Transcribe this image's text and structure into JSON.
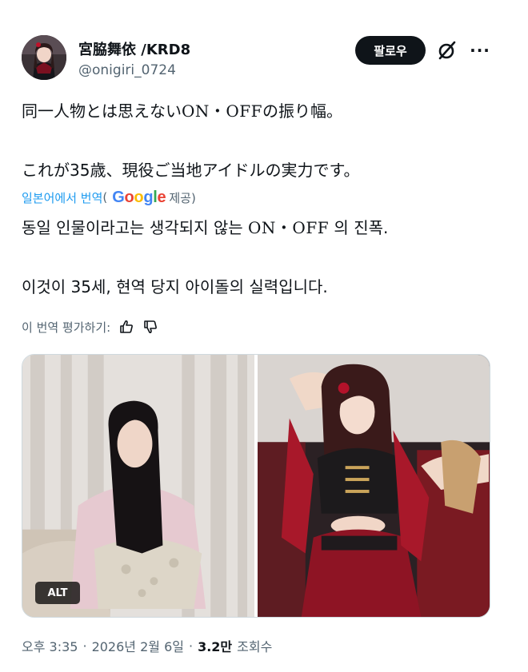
{
  "author": {
    "display_name": "宮脇舞依 /KRD8",
    "handle": "@onigiri_0724"
  },
  "actions": {
    "follow_label": "팔로우",
    "grok_icon": "slashed-circle-icon",
    "more_icon": "ellipsis-icon",
    "more_label": "···"
  },
  "post": {
    "line1_before": "同一人物とは思えない",
    "line1_onoff": "ON・OFF",
    "line1_after": "の振り幅。",
    "line2": "これが35歳、現役ご当地アイドルの実力です。"
  },
  "translation": {
    "link_label": "일본어에서 번역",
    "by_open": "(",
    "google": "Google",
    "by_close": "제공)",
    "line1_before": "동일 인물이라고는 생각되지 않는 ",
    "line1_onoff": "ON・OFF",
    "line1_after": " 의 진폭.",
    "line2": "이것이 35세, 현역 당지 아이돌의 실력입니다.",
    "rate_label": "이 번역 평가하기:"
  },
  "media": {
    "alt_badge": "ALT"
  },
  "meta": {
    "time": "오후 3:35",
    "date": "2026년 2월 6일",
    "views_count": "3.2만",
    "views_label": "조회수",
    "separator": "·"
  },
  "colors": {
    "link": "#1d9bf0",
    "text": "#0f1419",
    "secondary": "#536471"
  }
}
